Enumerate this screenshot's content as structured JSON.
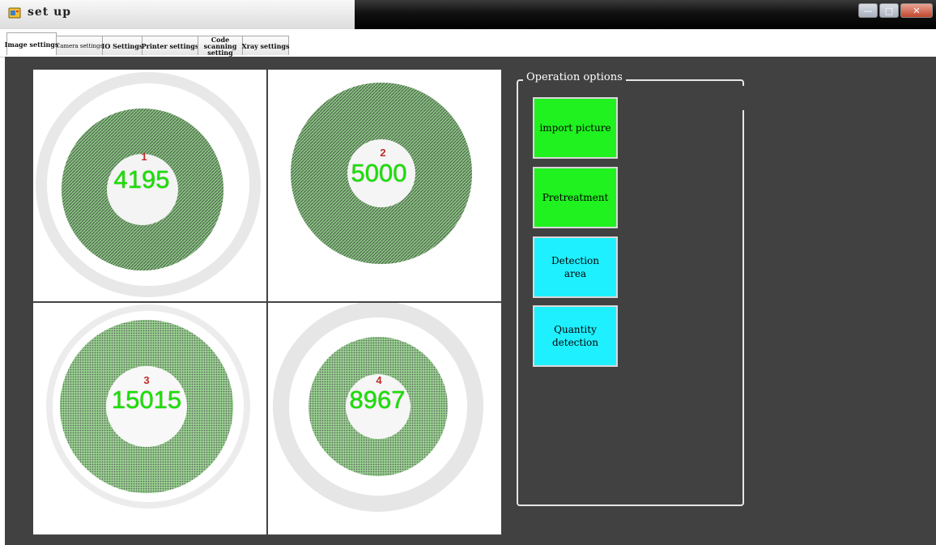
{
  "window": {
    "title": "set up",
    "icon": "app-icon",
    "controls": [
      "minimize",
      "maximize",
      "close"
    ]
  },
  "tabs": [
    {
      "label": "Image settings",
      "active": true
    },
    {
      "label": "Camera settings",
      "active": false
    },
    {
      "label": "IO Settings",
      "active": false
    },
    {
      "label": "Printer settings",
      "active": false
    },
    {
      "label": "Code scanning setting",
      "active": false
    },
    {
      "label": "Xray settings",
      "active": false
    }
  ],
  "images": [
    {
      "index": "1",
      "count": "4195"
    },
    {
      "index": "2",
      "count": "5000"
    },
    {
      "index": "3",
      "count": "15015"
    },
    {
      "index": "4",
      "count": "8967"
    }
  ],
  "operations": {
    "title": "Operation options",
    "buttons": [
      {
        "label": "import picture",
        "color": "#1ff21f"
      },
      {
        "label": "Pretreatment",
        "color": "#1ff21f"
      },
      {
        "label": "Detection area",
        "color": "#1ff0ff"
      },
      {
        "label": "Quantity detection",
        "color": "#1ff0ff"
      }
    ]
  }
}
